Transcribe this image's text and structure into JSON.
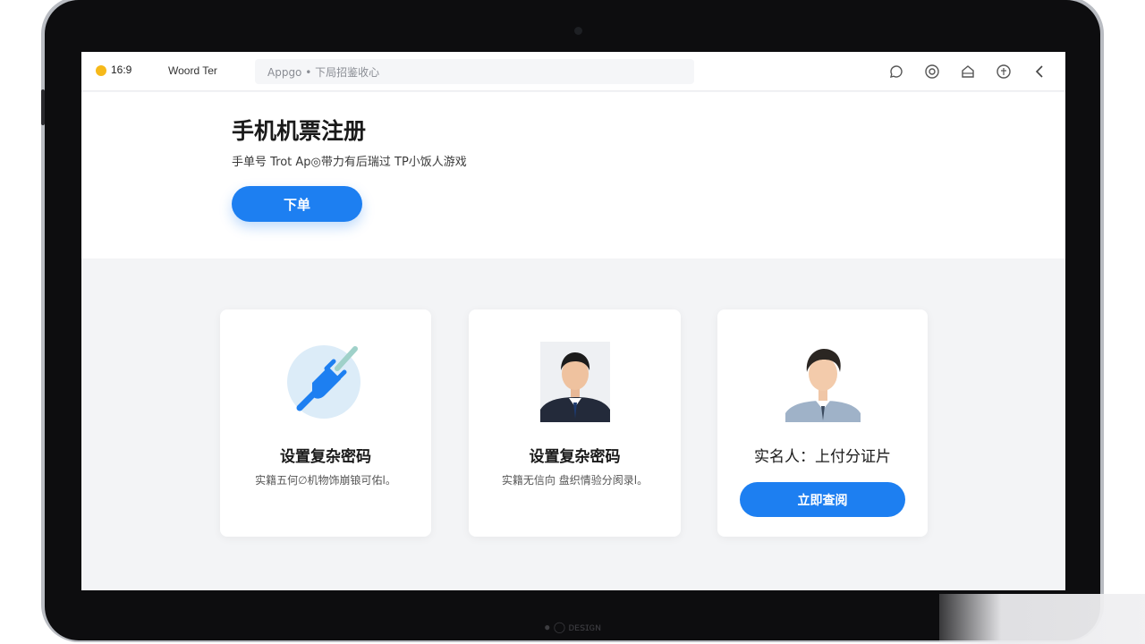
{
  "status": {
    "time": "16:9",
    "dot_color": "#f6b91a"
  },
  "app": {
    "name": "Woord Ter"
  },
  "url_bar": {
    "text": "Appgo • 下局招鉴收心"
  },
  "toolbar_icons": [
    "chat-icon",
    "target-icon",
    "home-icon",
    "shield-icon",
    "back-icon"
  ],
  "hero": {
    "title": "手机机票注册",
    "subtitle": "手单号 Trot Ap◎带力有后瑞过 TP小饭人游戏",
    "button_label": "下单"
  },
  "cards": [
    {
      "title": "设置复杂密码",
      "description": "实籍五何∅机物饰崩锒可佑l。",
      "media": "plug-icon"
    },
    {
      "title": "设置复杂密码",
      "description": "实籍无信向 盘织情验分阂录l。",
      "media": "portrait-man-suit"
    },
    {
      "title": "实名人：上付分证片",
      "button_label": "立即查阅",
      "media": "portrait-young-man"
    }
  ],
  "device": {
    "brand": "● ◯ ᴅᴇꜱɪɢɴ"
  },
  "colors": {
    "accent": "#1d7ff1",
    "background": "#f3f4f6",
    "frame": "#0d0d0f"
  }
}
